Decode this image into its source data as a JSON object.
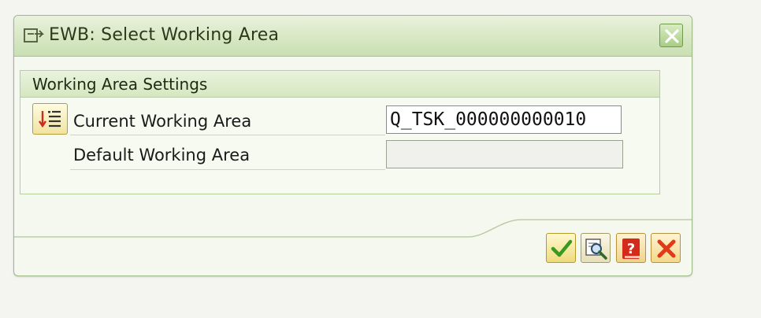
{
  "dialog": {
    "title": "EWB: Select Working Area"
  },
  "group": {
    "title": "Working Area Settings",
    "rows": [
      {
        "label": "Current Working Area",
        "value": "Q_TSK_000000000010"
      },
      {
        "label": "Default Working Area",
        "value": ""
      }
    ]
  },
  "icons": {
    "title": "dialog-window-icon",
    "close": "close-icon",
    "value_help": "value-help-list-icon",
    "ok": "checkmark-icon",
    "search": "magnifier-icon",
    "help": "question-mark-icon",
    "cancel": "cancel-x-icon"
  },
  "colors": {
    "titlebar": "#c9dfb1",
    "ok": "#3a9a1e",
    "help": "#d22b1c",
    "cancel": "#e23a18"
  }
}
